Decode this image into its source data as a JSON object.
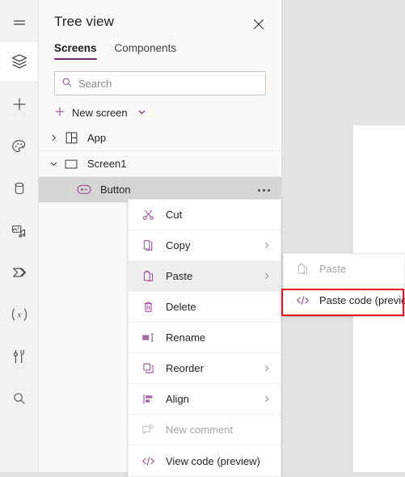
{
  "app": {
    "canvas": {
      "name": "app-canvas"
    }
  },
  "left_rail": {
    "items": [
      {
        "name": "hamburger-menu-icon",
        "label": "Menu",
        "active": false
      },
      {
        "name": "tree-view-icon",
        "label": "Tree view",
        "active": true
      },
      {
        "name": "insert-icon",
        "label": "Insert",
        "active": false
      },
      {
        "name": "theme-palette-icon",
        "label": "Theme",
        "active": false
      },
      {
        "name": "data-icon",
        "label": "Data",
        "active": false
      },
      {
        "name": "media-icon",
        "label": "Media",
        "active": false
      },
      {
        "name": "power-automate-icon",
        "label": "Power Automate",
        "active": false
      },
      {
        "name": "variables-icon",
        "label": "Variables",
        "active": false
      },
      {
        "name": "advanced-tools-icon",
        "label": "Advanced tools",
        "active": false
      },
      {
        "name": "search-icon",
        "label": "Search",
        "active": false
      }
    ]
  },
  "panel": {
    "title": "Tree view",
    "close_label": "Close",
    "tabs": [
      {
        "label": "Screens",
        "active": true
      },
      {
        "label": "Components",
        "active": false
      }
    ],
    "search": {
      "value": "",
      "placeholder": "Search"
    },
    "new_screen_label": "New screen"
  },
  "tree": {
    "rows": [
      {
        "label": "App",
        "icon": "app-grid-icon",
        "chevron": "chevron-right",
        "indent": "app",
        "selected": false,
        "ellipsis": false
      },
      {
        "label": "Screen1",
        "icon": "screen-rectangle-icon",
        "chevron": "chevron-down",
        "indent": "screen",
        "selected": false,
        "ellipsis": false
      },
      {
        "label": "Button",
        "icon": "button-control-icon",
        "chevron": "none",
        "indent": "button",
        "selected": true,
        "ellipsis": true
      }
    ]
  },
  "context_menu": {
    "items": [
      {
        "label": "Cut",
        "icon": "scissors-icon",
        "submenu": false,
        "disabled": false,
        "hover": false
      },
      {
        "label": "Copy",
        "icon": "copy-icon",
        "submenu": true,
        "disabled": false,
        "hover": false
      },
      {
        "label": "Paste",
        "icon": "paste-icon",
        "submenu": true,
        "disabled": false,
        "hover": true
      },
      {
        "label": "Delete",
        "icon": "trash-icon",
        "submenu": false,
        "disabled": false,
        "hover": false
      },
      {
        "label": "Rename",
        "icon": "rename-icon",
        "submenu": false,
        "disabled": false,
        "hover": false
      },
      {
        "label": "Reorder",
        "icon": "reorder-icon",
        "submenu": true,
        "disabled": false,
        "hover": false
      },
      {
        "label": "Align",
        "icon": "align-icon",
        "submenu": true,
        "disabled": false,
        "hover": false
      },
      {
        "label": "New comment",
        "icon": "comment-add-icon",
        "submenu": false,
        "disabled": true,
        "hover": false
      },
      {
        "label": "View code (preview)",
        "icon": "code-icon",
        "submenu": false,
        "disabled": false,
        "hover": false
      }
    ]
  },
  "submenu": {
    "items": [
      {
        "label": "Paste",
        "icon": "paste-icon",
        "disabled": true,
        "highlighted": false
      },
      {
        "label": "Paste code (preview)",
        "icon": "code-icon",
        "disabled": false,
        "highlighted": true
      }
    ]
  },
  "colors": {
    "accent_purple": "#742774",
    "icon_purple": "#9a4d9a",
    "highlight_red": "#e81123",
    "panel_bg": "#faf9f8",
    "canvas_bg": "#e3e3e3",
    "selected_row": "#d6d5d4"
  }
}
